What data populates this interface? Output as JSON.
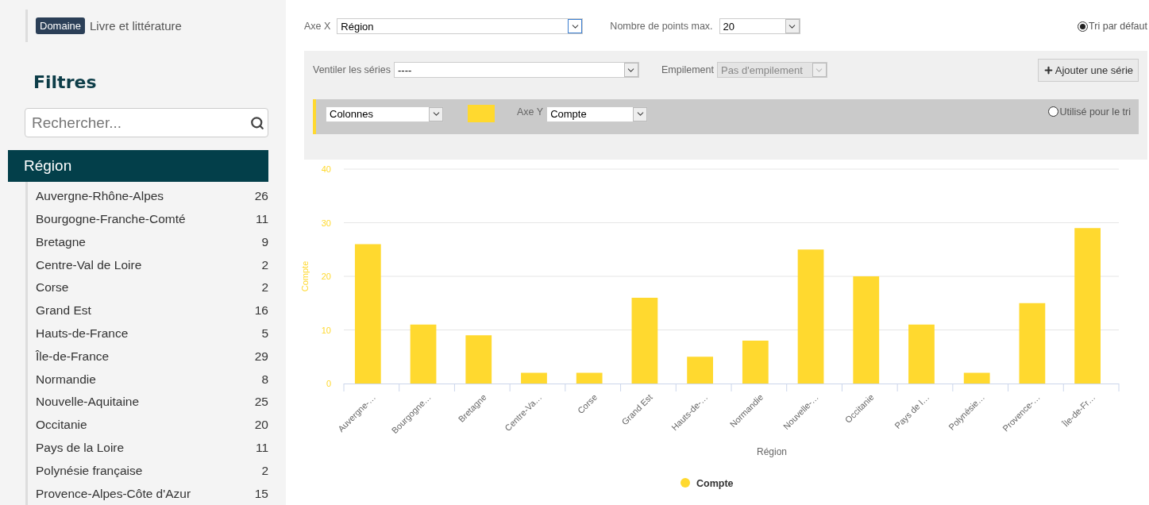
{
  "breadcrumb": {
    "tag": "Domaine",
    "value": "Livre et littérature"
  },
  "filters": {
    "title": "Filtres",
    "search": {
      "placeholder": "Rechercher..."
    },
    "facet": {
      "title": "Région",
      "items": [
        {
          "name": "Auvergne-Rhône-Alpes",
          "count": "26"
        },
        {
          "name": "Bourgogne-Franche-Comté",
          "count": "11"
        },
        {
          "name": "Bretagne",
          "count": "9"
        },
        {
          "name": "Centre-Val de Loire",
          "count": "2"
        },
        {
          "name": "Corse",
          "count": "2"
        },
        {
          "name": "Grand Est",
          "count": "16"
        },
        {
          "name": "Hauts-de-France",
          "count": "5"
        },
        {
          "name": "Île-de-France",
          "count": "29"
        },
        {
          "name": "Normandie",
          "count": "8"
        },
        {
          "name": "Nouvelle-Aquitaine",
          "count": "25"
        },
        {
          "name": "Occitanie",
          "count": "20"
        },
        {
          "name": "Pays de la Loire",
          "count": "11"
        },
        {
          "name": "Polynésie française",
          "count": "2"
        },
        {
          "name": "Provence-Alpes-Côte d'Azur",
          "count": "15"
        }
      ]
    }
  },
  "controls": {
    "x_axis": {
      "label": "Axe X",
      "value": "Région",
      "focused": true
    },
    "max_points": {
      "label": "Nombre de points max.",
      "value": "20"
    },
    "default_sort": {
      "label": "Tri par défaut",
      "selected": true
    },
    "breakdown": {
      "label": "Ventiler les séries",
      "value": "----"
    },
    "stacking": {
      "label": "Empilement",
      "value": "Pas d'empilement",
      "disabled": true
    },
    "add_series": "Ajouter une série",
    "series": [
      {
        "type": "Colonnes",
        "color": "#ffd92f",
        "y_label": "Axe Y",
        "y_value": "Compte",
        "sort": {
          "label": "Utilisé pour le tri",
          "selected": false
        }
      }
    ]
  },
  "chart": {
    "chart_data": {
      "type": "bar",
      "xlabel": "Région",
      "ylabel": "Compte",
      "categories": [
        "Auvergne-…",
        "Bourgogne…",
        "Bretagne",
        "Centre-Va…",
        "Corse",
        "Grand Est",
        "Hauts-de-…",
        "Normandie",
        "Nouvelle-…",
        "Occitanie",
        "Pays de l…",
        "Polynésie…",
        "Provence-…",
        "Île-de-Fr…"
      ],
      "series": [
        {
          "name": "Compte",
          "color": "#ffd92f",
          "values": [
            26,
            11,
            9,
            2,
            2,
            16,
            5,
            8,
            25,
            20,
            11,
            2,
            15,
            29
          ]
        }
      ],
      "ylim": [
        0,
        40
      ],
      "yticks": [
        0,
        10,
        20,
        30,
        40
      ],
      "grid": true
    }
  }
}
